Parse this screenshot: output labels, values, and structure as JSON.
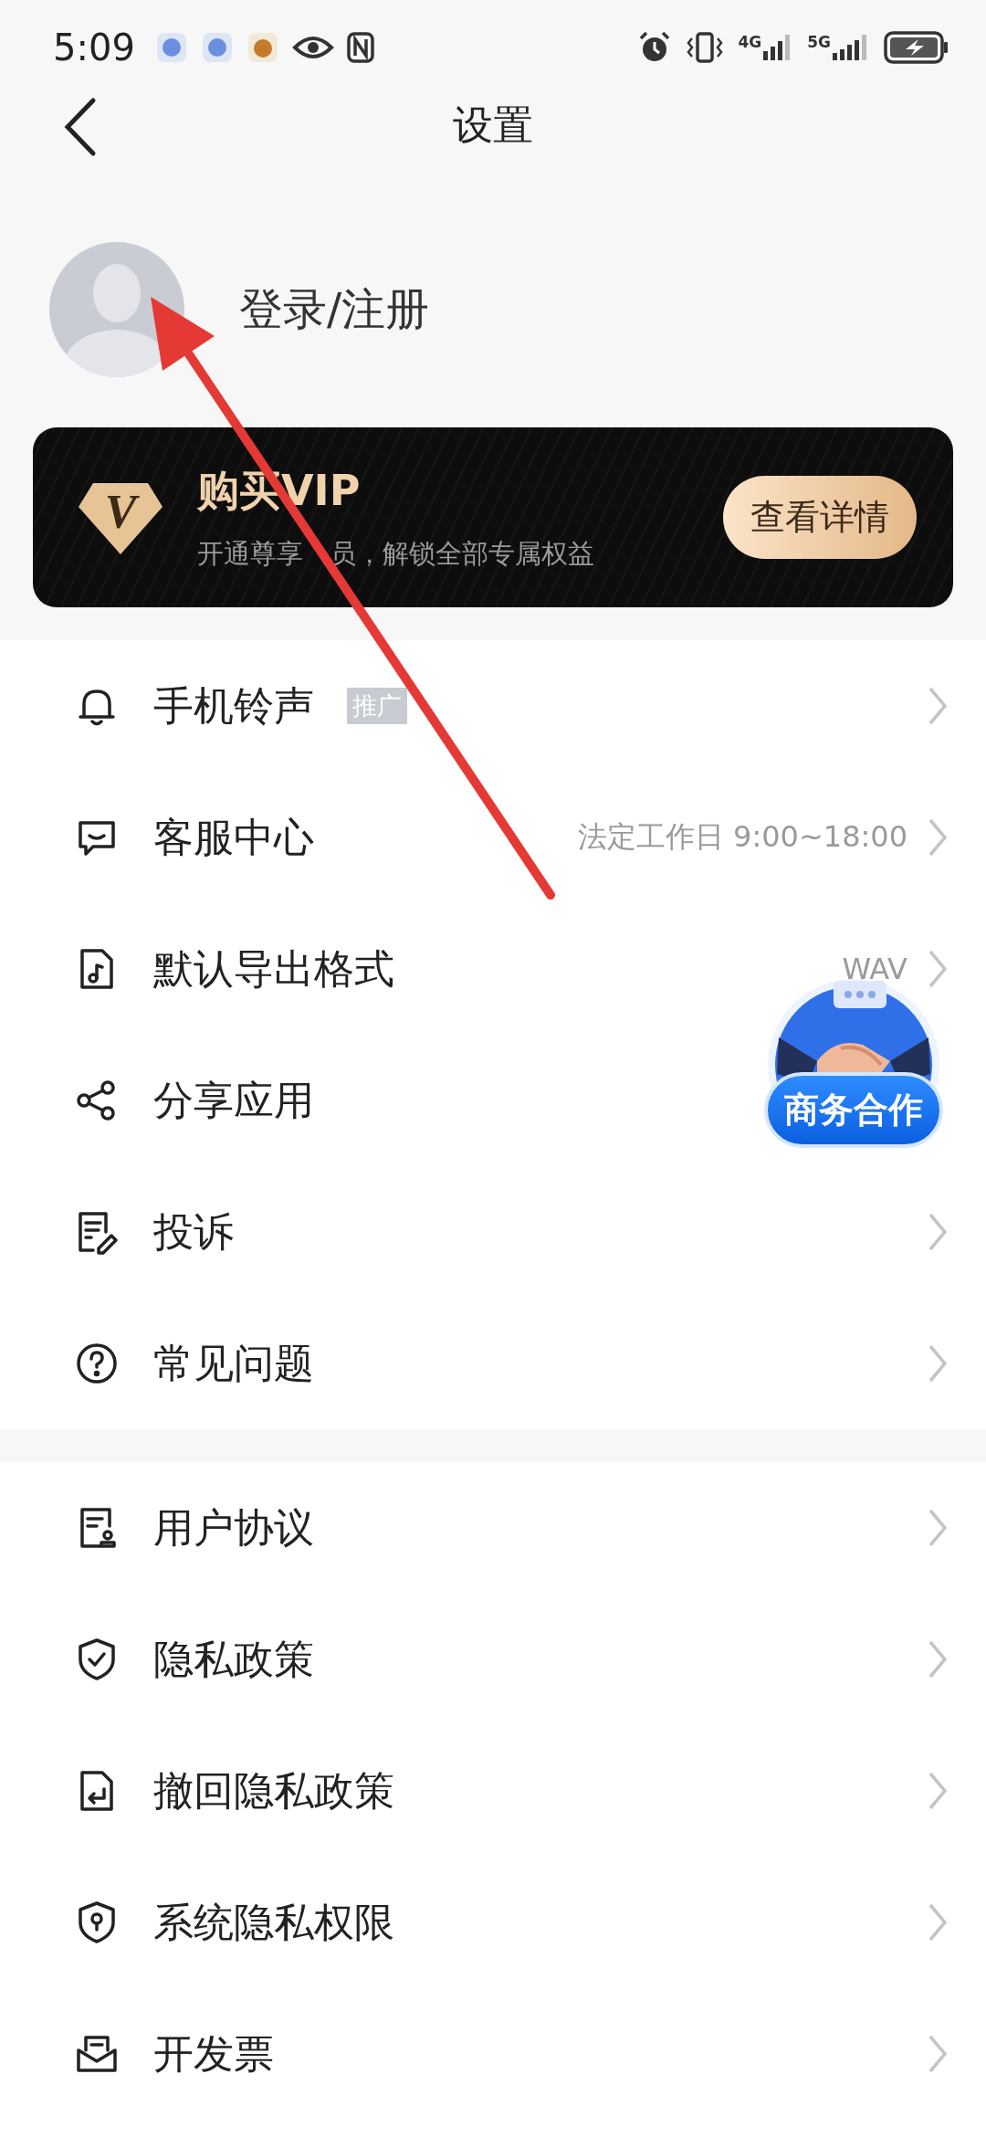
{
  "status_bar": {
    "time": "5:09",
    "network_1": "4G",
    "network_2": "5G"
  },
  "header": {
    "title": "设置"
  },
  "profile": {
    "label": "登录/注册"
  },
  "vip_banner": {
    "logo_letter": "V",
    "title": "购买VIP",
    "subtitle_start": "开通尊享",
    "subtitle_end": "员，解锁全部专属权益",
    "button": "查看详情"
  },
  "sections": [
    {
      "items": [
        {
          "label": "手机铃声",
          "badge": "推广",
          "chevron": true
        },
        {
          "label": "客服中心",
          "value": "法定工作日 9:00~18:00",
          "chevron": true
        },
        {
          "label": "默认导出格式",
          "value": "WAV",
          "chevron": true
        },
        {
          "label": "分享应用",
          "chevron": false
        },
        {
          "label": "投诉",
          "chevron": true
        },
        {
          "label": "常见问题",
          "chevron": true
        }
      ]
    },
    {
      "items": [
        {
          "label": "用户协议",
          "chevron": true
        },
        {
          "label": "隐私政策",
          "chevron": true
        },
        {
          "label": "撤回隐私政策",
          "chevron": true
        },
        {
          "label": "系统隐私权限",
          "chevron": true
        },
        {
          "label": "开发票",
          "chevron": true
        }
      ]
    }
  ],
  "float_button": {
    "label": "商务合作"
  }
}
